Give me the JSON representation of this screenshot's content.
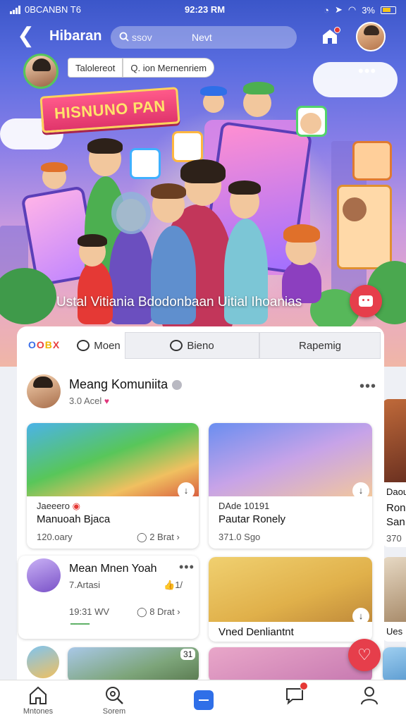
{
  "status_bar": {
    "carrier": "0BCANBN T6",
    "time": "92:23 RM",
    "battery": "3%"
  },
  "header": {
    "back_glyph": "❮",
    "title": "Hibaran",
    "search_placeholder": "ssov",
    "search_value": "Nevt"
  },
  "chips": [
    "Talolereot",
    "Q. ion Mernenriem"
  ],
  "hero": {
    "banner_text": "HISNUNO PAN",
    "caption": "Ustal Vitiania Bdodonbaan Uitial Ihoanias",
    "more_glyph": "•••"
  },
  "tabs": {
    "brand_letters": [
      {
        "ch": "O",
        "color": "#3b6ee8"
      },
      {
        "ch": "O",
        "color": "#e84040"
      },
      {
        "ch": "B",
        "color": "#f0b400"
      },
      {
        "ch": "X",
        "color": "#e84040"
      }
    ],
    "items": [
      "Moen",
      "Bieno",
      "Rapemig"
    ]
  },
  "community": {
    "name": "Meang Komuniita",
    "meta": "3.0 Acel",
    "more": "•••"
  },
  "posts": [
    {
      "tag": "Jaeeero",
      "title": "Manuoah Bjaca",
      "stat": "120.oary",
      "comments": "2 Brat",
      "dl": "↓"
    },
    {
      "tag": "DAde 10191",
      "title": "Pautar Ronely",
      "stat": "371.0 Sgo",
      "dl": "↓"
    },
    {
      "title": "Mean Mnen Yoah",
      "meta": "7.Artasi",
      "likes": "1/",
      "stat": "19:31 WV",
      "comments": "8 Drat",
      "more": "•••",
      "green_tag": "━━━━━"
    },
    {
      "title": "Vned Denliantnt",
      "dl": "↓"
    },
    {
      "badge": "31"
    }
  ],
  "right_peek": {
    "items": [
      "Daou",
      "Ron",
      "San",
      "370"
    ],
    "label2": "Ues"
  },
  "nav": {
    "items": [
      {
        "label": "Mntones"
      },
      {
        "label": "Sorem"
      },
      {
        "label": ""
      },
      {
        "label": ""
      },
      {
        "label": ""
      }
    ]
  },
  "colors": {
    "accent": "#2f6fe8",
    "live": "#e63e4b",
    "hero_top": "#3b56c9"
  }
}
